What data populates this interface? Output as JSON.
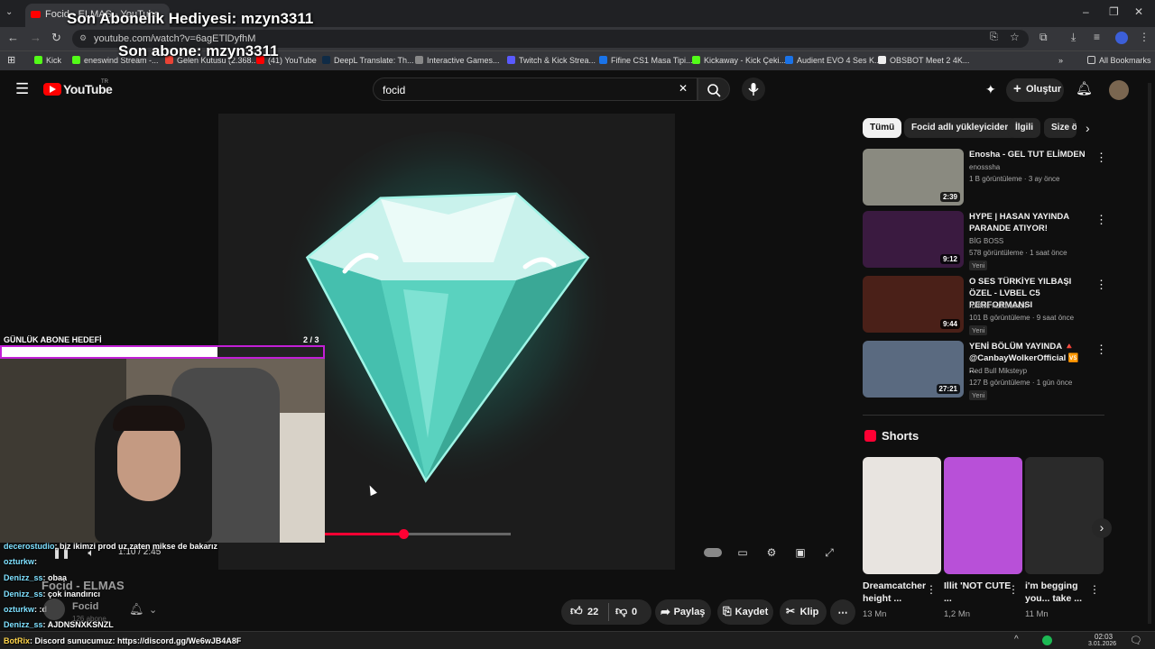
{
  "browser": {
    "tab_title": "Focid - ELMAS - YouTube",
    "url": "youtube.com/watch?v=6agETlDyfhM",
    "bookmarks": [
      {
        "label": "Kick",
        "color": "#53fc18"
      },
      {
        "label": "eneswind Stream -...",
        "color": "#53fc18"
      },
      {
        "label": "Gelen Kutusu (2.368...",
        "color": "#ea4335"
      },
      {
        "label": "(41) YouTube",
        "color": "#ff0000"
      },
      {
        "label": "DeepL Translate: Th...",
        "color": "#0f2b46"
      },
      {
        "label": "Interactive Games...",
        "color": "#888888"
      },
      {
        "label": "Twitch & Kick Strea...",
        "color": "#5a5aff"
      },
      {
        "label": "Fifine CS1 Masa Tipi...",
        "color": "#1a73e8"
      },
      {
        "label": "Kickaway - Kick Çeki...",
        "color": "#53fc18"
      },
      {
        "label": "Audient EVO 4 Ses K...",
        "color": "#1a73e8"
      },
      {
        "label": "OBSBOT Meet 2 4K...",
        "color": "#eeeeee"
      }
    ],
    "all_bookmarks": "All Bookmarks"
  },
  "overlay": {
    "last_gift": "Son Abonelik Hediyesi: mzyn3311",
    "last_sub": "Son abone: mzyn3311",
    "goal_label": "GÜNLÜK ABONE HEDEFİ",
    "goal_count": "2  / 3",
    "goal_progress": 0.67
  },
  "header": {
    "logo": "YouTube",
    "logo_region": "TR",
    "search_value": "focid",
    "create_label": "Oluştur"
  },
  "player": {
    "time": "1:10 / 2:45",
    "progress": 0.42,
    "video_title": "Focid - ELMAS",
    "channel": "Focid",
    "subs": "126 abone"
  },
  "chat": [
    {
      "name": "decerostudio",
      "text": ": biz ikimzi prod uz zaten mikse de bakarız"
    },
    {
      "name": "ozturkw",
      "text": ":"
    },
    {
      "name": "Denizz_ss",
      "text": ": obaa"
    },
    {
      "name": "Denizz_ss",
      "text": ": çok inandırıcı"
    },
    {
      "name": "ozturkw",
      "text": ": :d"
    },
    {
      "name": "Denizz_ss",
      "text": ": AJDNSNXKSNZL"
    },
    {
      "name": "BotRix",
      "text": ": Discord sunucumuz: https://discord.gg/We6wJB4A8F"
    }
  ],
  "actions": {
    "likes": "22",
    "dislikes": "0",
    "share": "Paylaş",
    "save": "Kaydet",
    "clip": "Klip"
  },
  "chips": [
    "Tümü",
    "Focid adlı yükleyiciden",
    "İlgili",
    "Size ö"
  ],
  "recommendations": [
    {
      "title": "Enosha - GEL TUT ELİMDEN",
      "channel": "enosssha",
      "meta": "1 B görüntüleme · 3 ay önce",
      "duration": "2:39",
      "new": "",
      "thumb": "#8a8a80"
    },
    {
      "title": "HYPE | HASAN YAYINDA PARANDE ATIYOR!",
      "channel": "BİG BOSS",
      "meta": "578 görüntüleme · 1 saat önce",
      "duration": "9:12",
      "new": "Yeni",
      "thumb": "#3a1a40"
    },
    {
      "title": "O SES TÜRKİYE YILBAŞI ÖZEL - LVBEL C5 PERFORMANSI",
      "channel": "rufflws nulldreinull",
      "meta": "101 B görüntüleme · 9 saat önce",
      "duration": "9:44",
      "new": "Yeni",
      "thumb": "#4a2018"
    },
    {
      "title": "YENİ BÖLÜM YAYINDA 🔺 @CanbayWolkerOfficial 🆚 ...",
      "channel": "Red Bull Mikstеyp",
      "meta": "127 B görüntüleme · 1 gün önce",
      "duration": "27:21",
      "new": "Yeni",
      "thumb": "#5a6a80"
    }
  ],
  "shorts_label": "Shorts",
  "shorts": [
    {
      "title": "Dreamcatcher height ...",
      "views": "13 Mn",
      "thumb": "#e8e4e0"
    },
    {
      "title": "Illit 'NOT CUTE ...",
      "views": "1,2 Mn",
      "thumb": "#b850d8"
    },
    {
      "title": "i'm begging you... take ...",
      "views": "11 Mn",
      "thumb": "#2a2a2a"
    }
  ],
  "taskbar": {
    "time": "02:03",
    "date": "3.01.2026"
  }
}
